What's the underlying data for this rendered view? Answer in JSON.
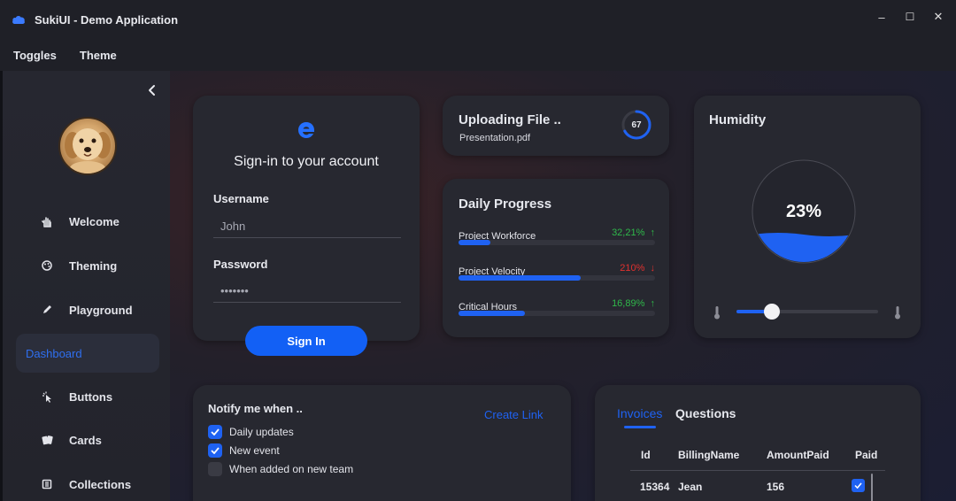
{
  "window": {
    "title": "SukiUI - Demo Application",
    "controls": {
      "minimize": "–",
      "maximize": "☐",
      "close": "✕"
    }
  },
  "menu": {
    "items": [
      "Toggles",
      "Theme"
    ]
  },
  "sidebar": {
    "items": [
      {
        "label": "Welcome",
        "icon": "hand-icon"
      },
      {
        "label": "Theming",
        "icon": "palette-icon"
      },
      {
        "label": "Playground",
        "icon": "pen-icon"
      },
      {
        "label": "Dashboard",
        "icon": "dashboard-icon",
        "active": true
      },
      {
        "label": "Buttons",
        "icon": "pointer-icon"
      },
      {
        "label": "Cards",
        "icon": "cards-icon"
      },
      {
        "label": "Collections",
        "icon": "collections-icon"
      }
    ]
  },
  "signin": {
    "title": "Sign-in to your account",
    "username_label": "Username",
    "username_value": "John",
    "password_label": "Password",
    "password_value": "•••••••",
    "button": "Sign In"
  },
  "upload": {
    "title": "Uploading File ..",
    "file": "Presentation.pdf",
    "progress": 67,
    "progress_label": "67"
  },
  "daily_progress": {
    "title": "Daily Progress",
    "rows": [
      {
        "name": "Project Workforce",
        "value": "32,21%",
        "trend": "↑",
        "status": "up",
        "fill": 0.16
      },
      {
        "name": "Project Velocity",
        "value": "210%",
        "trend": "↓",
        "status": "down",
        "fill": 0.62
      },
      {
        "name": "Critical Hours",
        "value": "16,89%",
        "trend": "↑",
        "status": "up",
        "fill": 0.34
      }
    ]
  },
  "humidity": {
    "title": "Humidity",
    "value": 23,
    "value_label": "23%",
    "slider_value": 0.25
  },
  "notify": {
    "title": "Notify me when ..",
    "create_link": "Create Link",
    "options": [
      {
        "label": "Daily updates",
        "checked": true
      },
      {
        "label": "New event",
        "checked": true
      },
      {
        "label": "When added on new team",
        "checked": false
      }
    ]
  },
  "invoices": {
    "tabs": [
      "Invoices",
      "Questions"
    ],
    "columns": [
      "Id",
      "BillingName",
      "AmountPaid",
      "Paid"
    ],
    "rows": [
      {
        "id": "15364",
        "name": "Jean",
        "amount": "156",
        "paid": true
      }
    ]
  },
  "colors": {
    "accent": "#1f62f2",
    "positive": "#2fb84a",
    "negative": "#e0312f"
  }
}
